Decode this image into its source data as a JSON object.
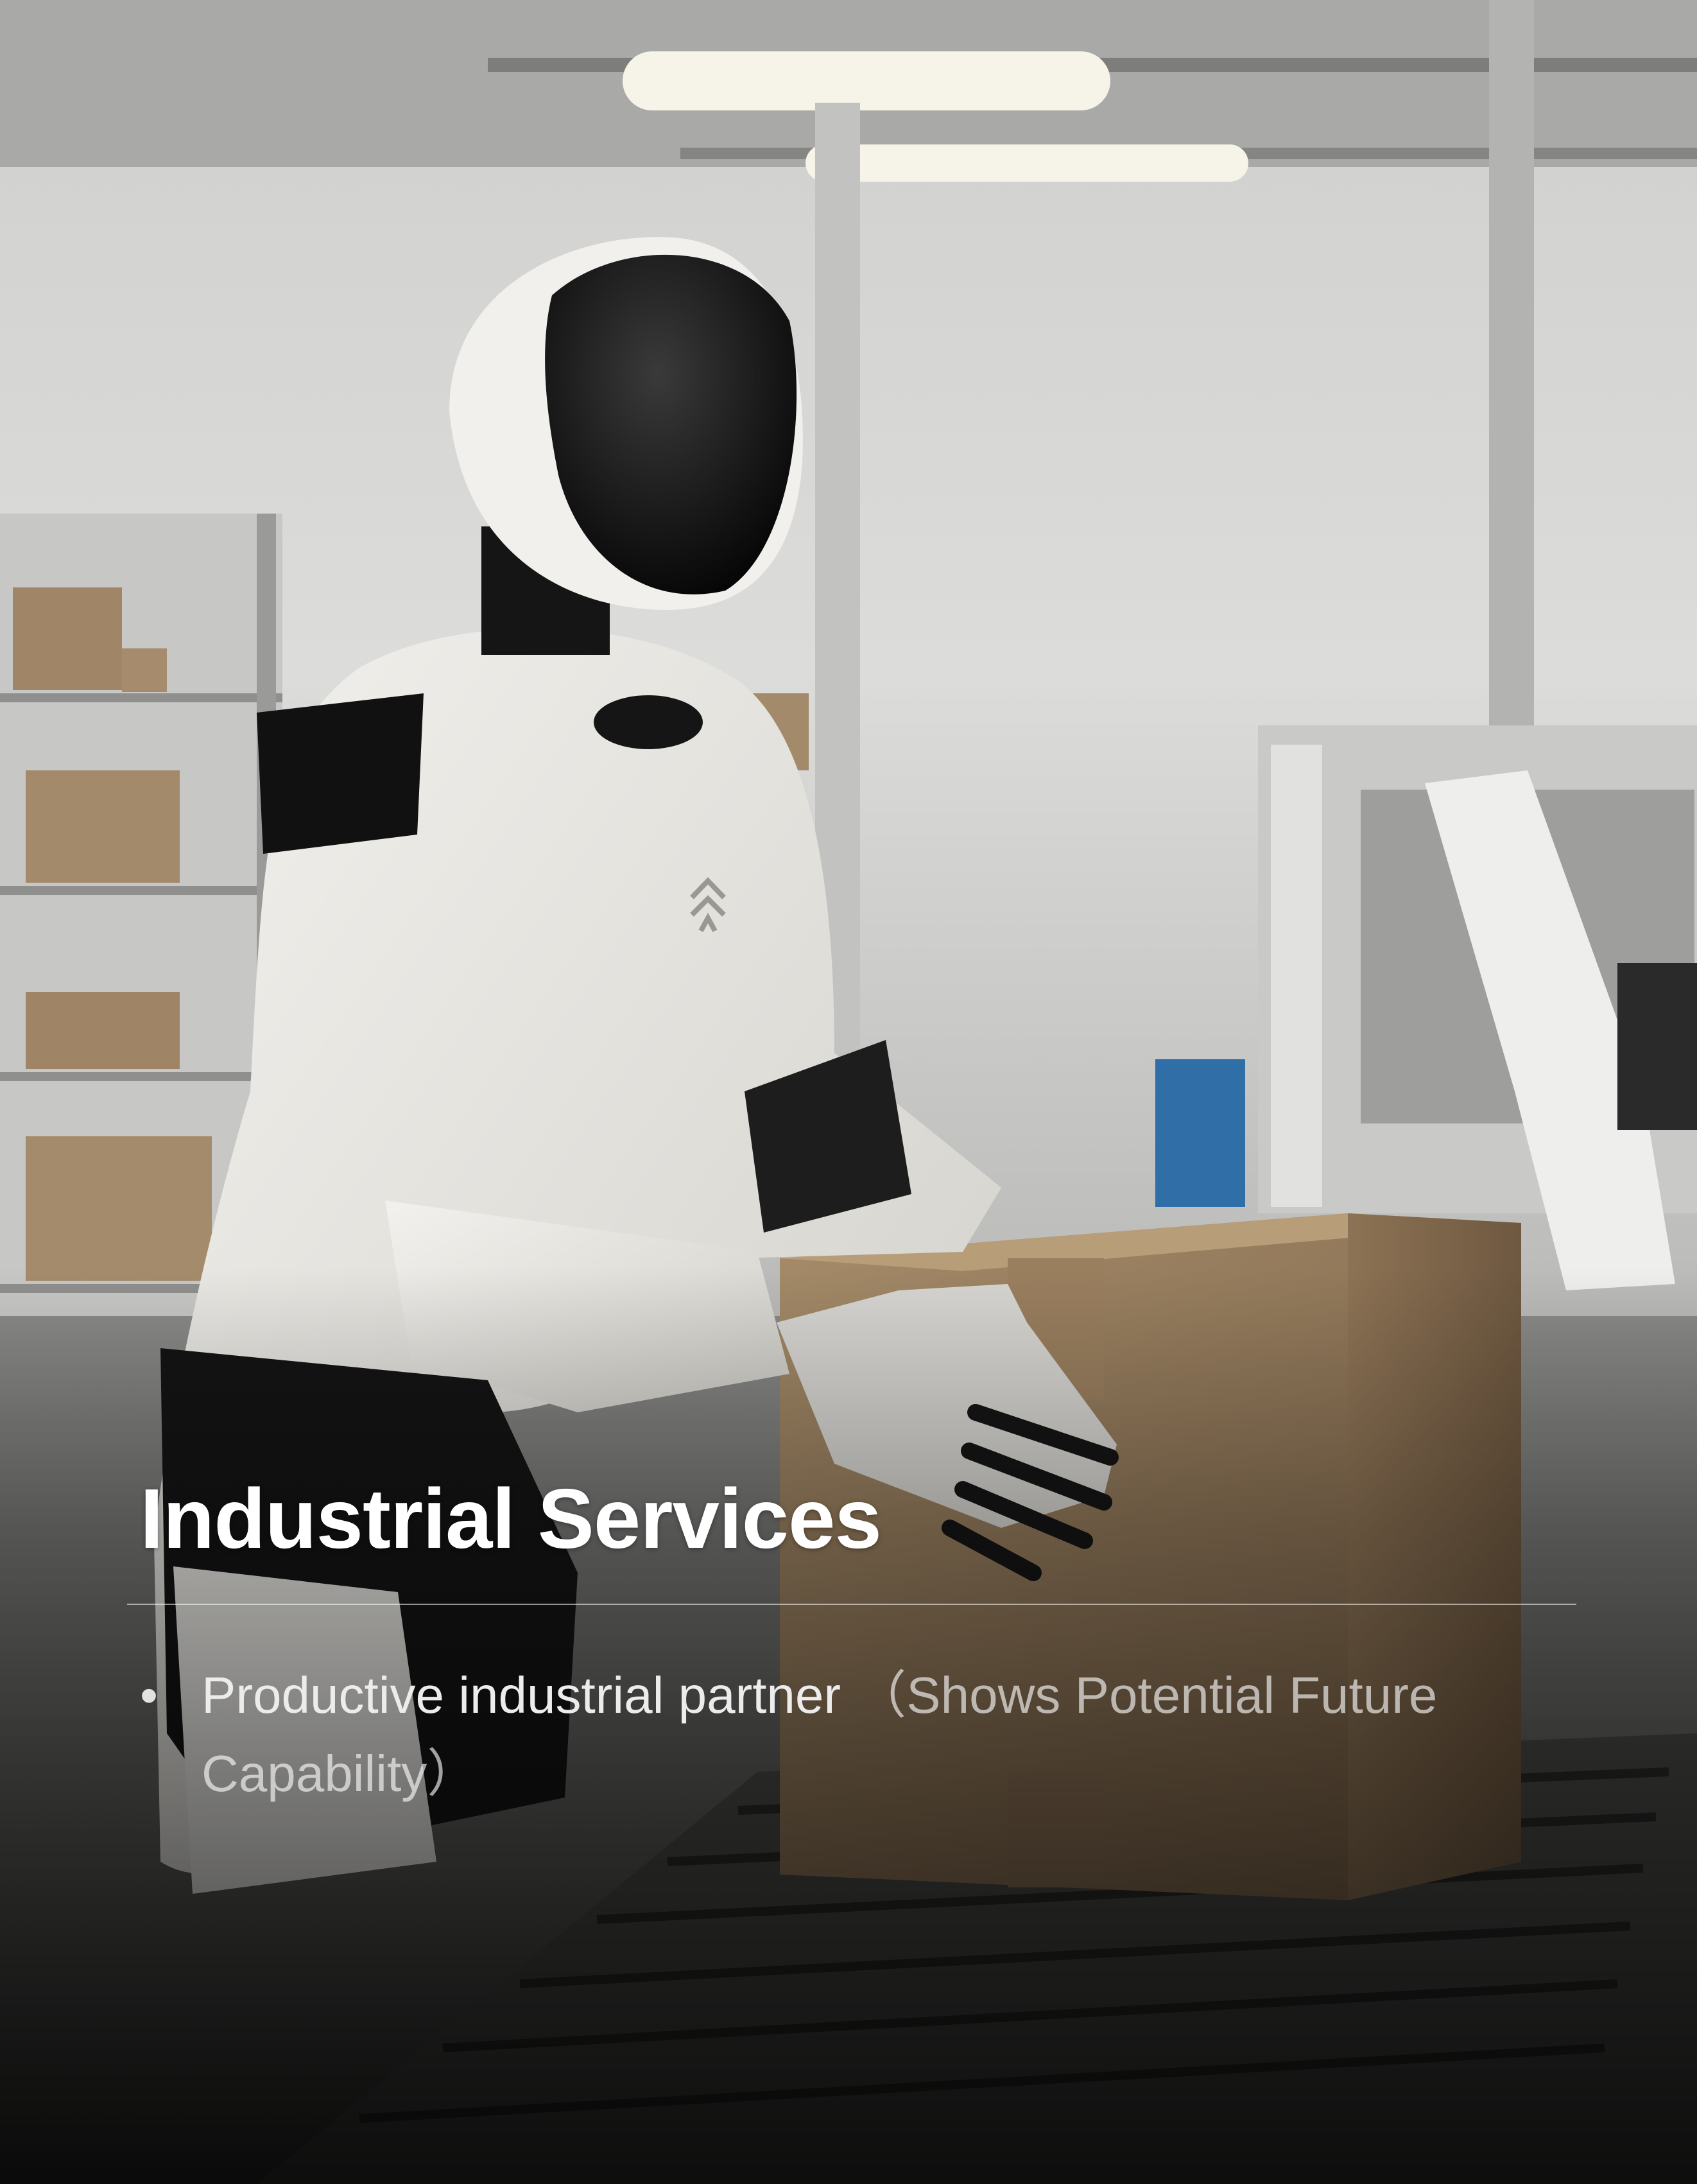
{
  "slide": {
    "title": "Industrial Services",
    "bullets": [
      {
        "marker": "•",
        "text": "Productive industrial partner",
        "note": "（Shows Potential Future Capability）"
      }
    ]
  },
  "image": {
    "description_icon": "humanoid-robot-warehouse-photo"
  }
}
